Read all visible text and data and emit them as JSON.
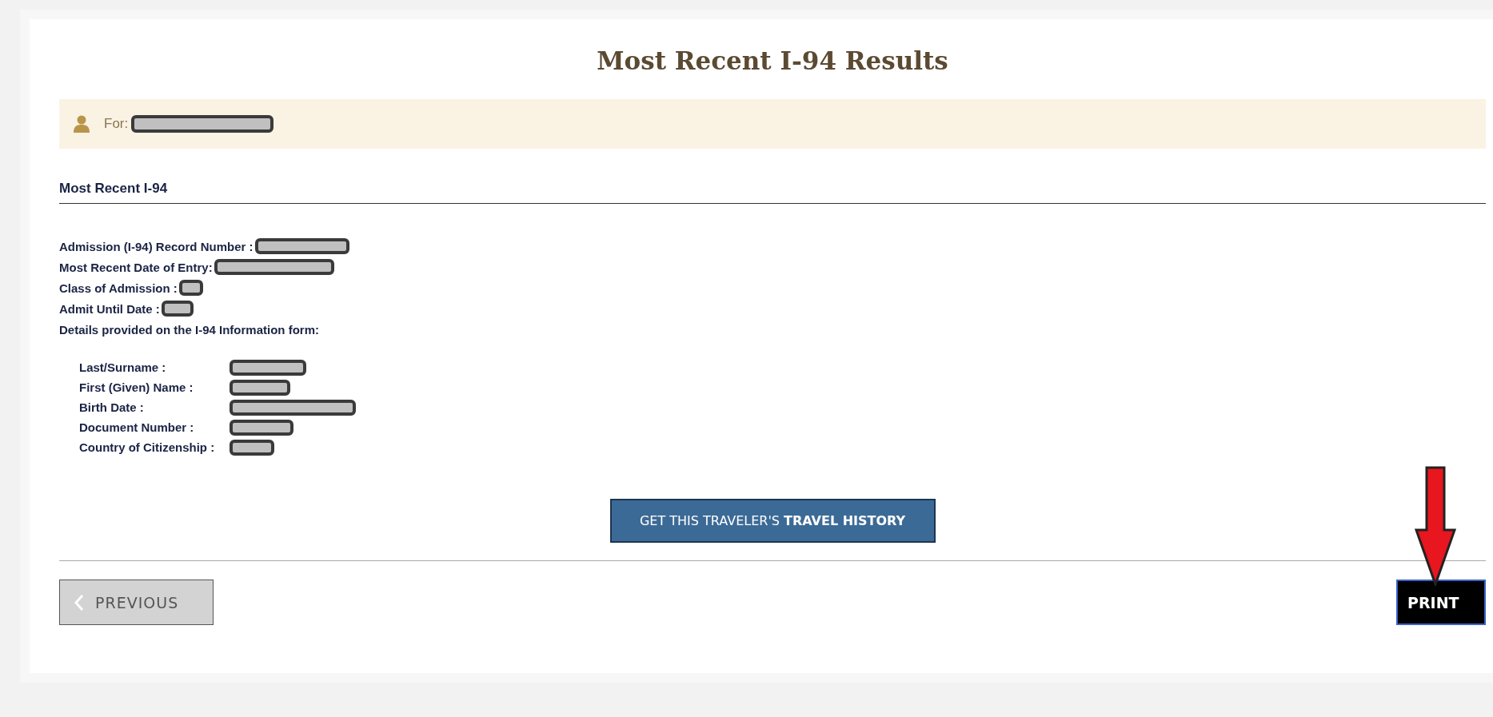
{
  "title": "Most Recent I-94 Results",
  "traveler": {
    "label": "For:"
  },
  "section": {
    "heading": "Most Recent I-94"
  },
  "record_fields": [
    {
      "label": "Admission (I-94) Record Number :"
    },
    {
      "label": "Most Recent Date of Entry:"
    },
    {
      "label": "Class of Admission :"
    },
    {
      "label": "Admit Until Date :"
    }
  ],
  "details_heading": "Details provided on the I-94 Information form:",
  "details_fields": [
    {
      "label": "Last/Surname :"
    },
    {
      "label": "First (Given) Name :"
    },
    {
      "label": "Birth Date :"
    },
    {
      "label": "Document Number :"
    },
    {
      "label": "Country of Citizenship :"
    }
  ],
  "history_button": {
    "text": "GET THIS TRAVELER'S **TRAVEL HISTORY**"
  },
  "buttons": {
    "previous": "PREVIOUS",
    "print": "PRINT"
  }
}
